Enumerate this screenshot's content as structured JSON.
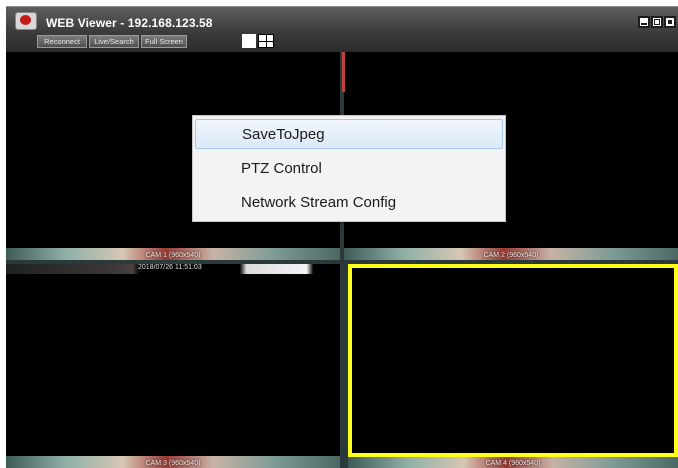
{
  "window": {
    "title": "WEB Viewer - 192.168.123.58"
  },
  "toolbar": {
    "reconnect_label": "Reconnect",
    "live_search_label": "Live/Search",
    "full_screen_label": "Full Screen"
  },
  "cameras": [
    {
      "label": "CAM 1 (960x540)",
      "timestamp": "2018/07/26 11:51:03"
    },
    {
      "label": "CAM 2 (960x540)"
    },
    {
      "label": "CAM 3 (960x540)"
    },
    {
      "label": "CAM 4 (960x540)",
      "selected": true
    }
  ],
  "context_menu": {
    "items": [
      {
        "label": "SaveToJpeg",
        "hovered": true
      },
      {
        "label": "PTZ Control"
      },
      {
        "label": "Network Stream Config"
      }
    ]
  },
  "colors": {
    "selection_border": "#ffff1a",
    "titlebar_bg": "#3c3c3c",
    "video_bg": "#000000"
  }
}
